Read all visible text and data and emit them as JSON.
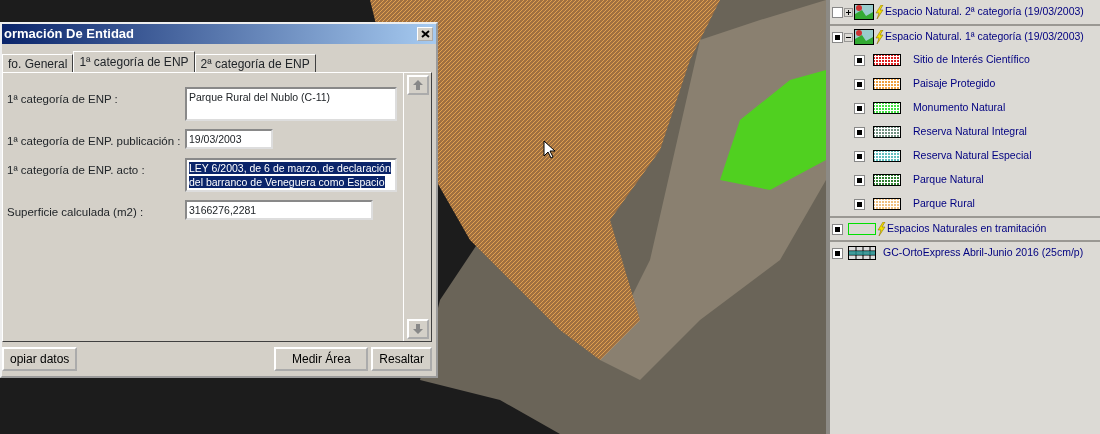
{
  "dialog": {
    "title": "ormación De Entidad",
    "tabs": [
      {
        "label": "fo. General",
        "selected": false
      },
      {
        "label": "1ª categoría de ENP",
        "selected": true
      },
      {
        "label": "2ª categoría de ENP",
        "selected": false
      }
    ],
    "fields": [
      {
        "label": "1ª categoría de ENP :",
        "value": "Parque Rural del Nublo (C-11)",
        "kind": "multiline",
        "selected": false
      },
      {
        "label": "1ª categoría de ENP. publicación :",
        "value": "19/03/2003",
        "kind": "short",
        "selected": false
      },
      {
        "label": "1ª categoría de ENP. acto :",
        "value": "LEY 6/2003, de 6 de marzo, de declaración del barranco de Veneguera como Espacio",
        "kind": "multiline",
        "selected": true
      },
      {
        "label": "Superficie calculada (m2) :",
        "value": "3166276,2281",
        "kind": "medium",
        "selected": false
      }
    ],
    "buttons": [
      "opiar datos",
      "Medir Área",
      "Resaltar"
    ]
  },
  "legend": {
    "layers": [
      {
        "label": "Espacio Natural. 2ª categoría (19/03/2003)",
        "kind": "vector-group",
        "checked": false,
        "expanded": false
      },
      {
        "label": "Espacio Natural. 1ª categoría (19/03/2003)",
        "kind": "vector-group",
        "checked": true,
        "expanded": true,
        "children": [
          {
            "label": "Sitio de Interés Científico",
            "checked": true,
            "color": "#e02020"
          },
          {
            "label": "Paisaje Protegido",
            "checked": true,
            "color": "#f0a040"
          },
          {
            "label": "Monumento Natural",
            "checked": true,
            "color": "#40e040"
          },
          {
            "label": "Reserva Natural Integral",
            "checked": true,
            "color": "#709080"
          },
          {
            "label": "Reserva Natural Especial",
            "checked": true,
            "color": "#60c0c0"
          },
          {
            "label": "Parque Natural",
            "checked": true,
            "color": "#308030"
          },
          {
            "label": "Parque Rural",
            "checked": true,
            "color": "#f0c080"
          }
        ]
      },
      {
        "label": "Espacios Naturales en tramitación",
        "kind": "vector-layer",
        "checked": true,
        "color": "#00e000"
      },
      {
        "label": "GC-OrtoExpress Abril-Junio 2016 (25cm/p)",
        "kind": "raster",
        "checked": true
      }
    ]
  }
}
